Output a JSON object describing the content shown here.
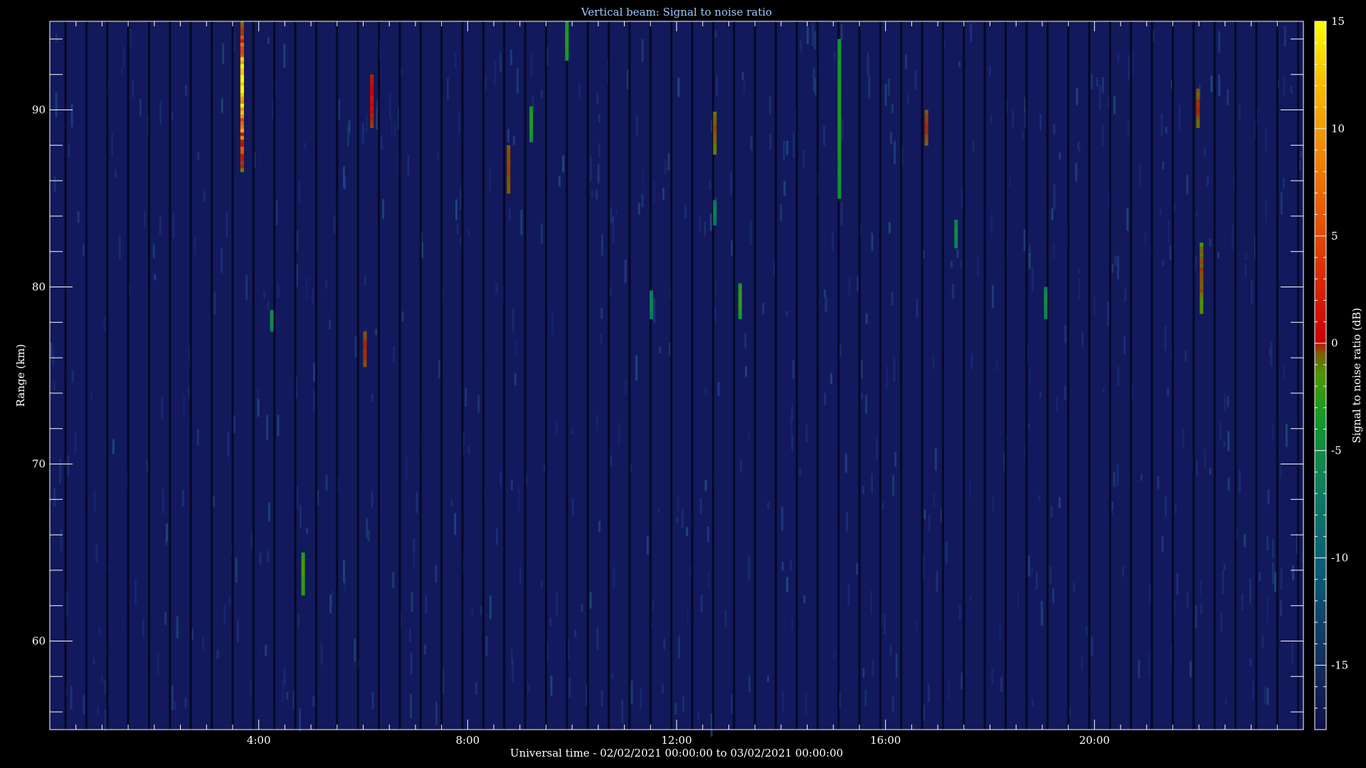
{
  "chart_data": {
    "type": "heatmap",
    "title": "Vertical beam: Signal to noise ratio",
    "xlabel": "Universal time - 02/02/2021 00:00:00 to 03/02/2021 00:00:00",
    "ylabel": "Range (km)",
    "colorbar_label": "Signal to noise ratio (dB)",
    "x_unit": "hours UT",
    "xlim": [
      0,
      24
    ],
    "ylim": [
      55,
      95
    ],
    "clim": [
      -18,
      15
    ],
    "x_ticks": [
      4,
      8,
      12,
      16,
      20
    ],
    "x_tick_labels": [
      "4:00",
      "8:00",
      "12:00",
      "16:00",
      "20:00"
    ],
    "y_ticks": [
      60,
      70,
      80,
      90
    ],
    "y_tick_labels": [
      "60",
      "70",
      "80",
      "90"
    ],
    "colorbar_ticks": [
      15,
      10,
      5,
      0,
      -5,
      -10,
      -15
    ],
    "colorbar_tick_labels": [
      "15",
      "10",
      "5",
      "0",
      "-5",
      "-10",
      "-15"
    ],
    "background_snr_db": -17,
    "colormap": [
      "#10104a",
      "#12305e",
      "#0a5a78",
      "#0d7a64",
      "#119a2a",
      "#4a9a00",
      "#7a6000",
      "#cc0000",
      "#e04000",
      "#f08000",
      "#f8c000",
      "#ffff00"
    ],
    "gap_interval_hours": 0.4,
    "events": [
      {
        "time": "3:41",
        "range_km": [
          86.5,
          95
        ],
        "snr_db": [
          -2,
          15
        ]
      },
      {
        "time": "4:15",
        "range_km": [
          77.5,
          78.7
        ],
        "snr_db": [
          -9,
          -7
        ]
      },
      {
        "time": "4:51",
        "range_km": [
          62.6,
          65
        ],
        "snr_db": [
          -5,
          -3
        ]
      },
      {
        "time": "6:02",
        "range_km": [
          75.5,
          77.5
        ],
        "snr_db": [
          0,
          2
        ]
      },
      {
        "time": "6:10",
        "range_km": [
          89,
          92
        ],
        "snr_db": [
          1,
          4
        ]
      },
      {
        "time": "8:47",
        "range_km": [
          85.3,
          88
        ],
        "snr_db": [
          0,
          1
        ]
      },
      {
        "time": "9:13",
        "range_km": [
          88.2,
          90.2
        ],
        "snr_db": [
          -7,
          -5
        ]
      },
      {
        "time": "9:54",
        "range_km": [
          92.8,
          95
        ],
        "snr_db": [
          -6,
          -5
        ]
      },
      {
        "time": "11:31",
        "range_km": [
          78.2,
          79.8
        ],
        "snr_db": [
          -10,
          -8
        ]
      },
      {
        "time": "12:44",
        "range_km": [
          87.5,
          89.9
        ],
        "snr_db": [
          -2,
          1
        ]
      },
      {
        "time": "12:44",
        "range_km": [
          83.5,
          84.9
        ],
        "snr_db": [
          -10,
          -8
        ]
      },
      {
        "time": "13:13",
        "range_km": [
          78.2,
          80.2
        ],
        "snr_db": [
          -6,
          -4
        ]
      },
      {
        "time": "15:07",
        "range_km": [
          85,
          94
        ],
        "snr_db": [
          -7,
          -5
        ]
      },
      {
        "time": "16:47",
        "range_km": [
          88,
          90
        ],
        "snr_db": [
          0,
          2
        ]
      },
      {
        "time": "17:21",
        "range_km": [
          82.2,
          83.8
        ],
        "snr_db": [
          -9,
          -7
        ]
      },
      {
        "time": "19:04",
        "range_km": [
          78.2,
          80
        ],
        "snr_db": [
          -9,
          -7
        ]
      },
      {
        "time": "21:59",
        "range_km": [
          89,
          91.2
        ],
        "snr_db": [
          -1,
          2
        ]
      },
      {
        "time": "22:03",
        "range_km": [
          78.5,
          82.5
        ],
        "snr_db": [
          -4,
          2
        ]
      }
    ]
  }
}
